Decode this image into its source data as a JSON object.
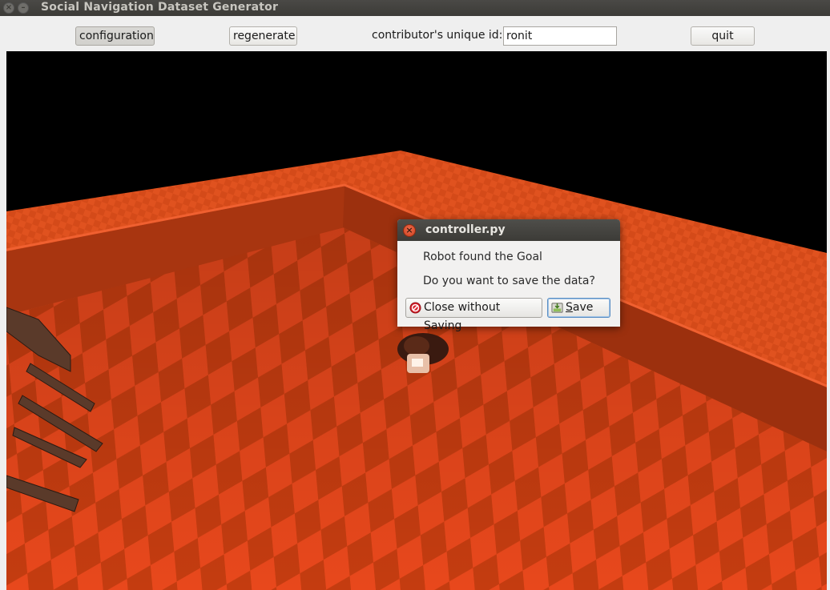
{
  "window": {
    "title": "Social Navigation Dataset Generator",
    "close_glyph": "×",
    "minimize_glyph": "–"
  },
  "toolbar": {
    "configuration_label": "configuration",
    "regenerate_label": "regenerate",
    "contributor_label": "contributor's unique id:",
    "contributor_value": "ronit",
    "quit_label": "quit"
  },
  "dialog": {
    "title": "controller.py",
    "close_glyph": "×",
    "message_1": "Robot found the Goal",
    "message_2": "Do you want to save the data?",
    "close_without_saving_label": "Close without Saving",
    "save_label": "Save",
    "close_without_saving_icon": "no-entry-icon",
    "save_icon": "save-icon"
  },
  "colors": {
    "floor_light": "#e8481c",
    "floor_dark": "#b8380e",
    "wall": "#c24014",
    "sky": "#000000"
  }
}
